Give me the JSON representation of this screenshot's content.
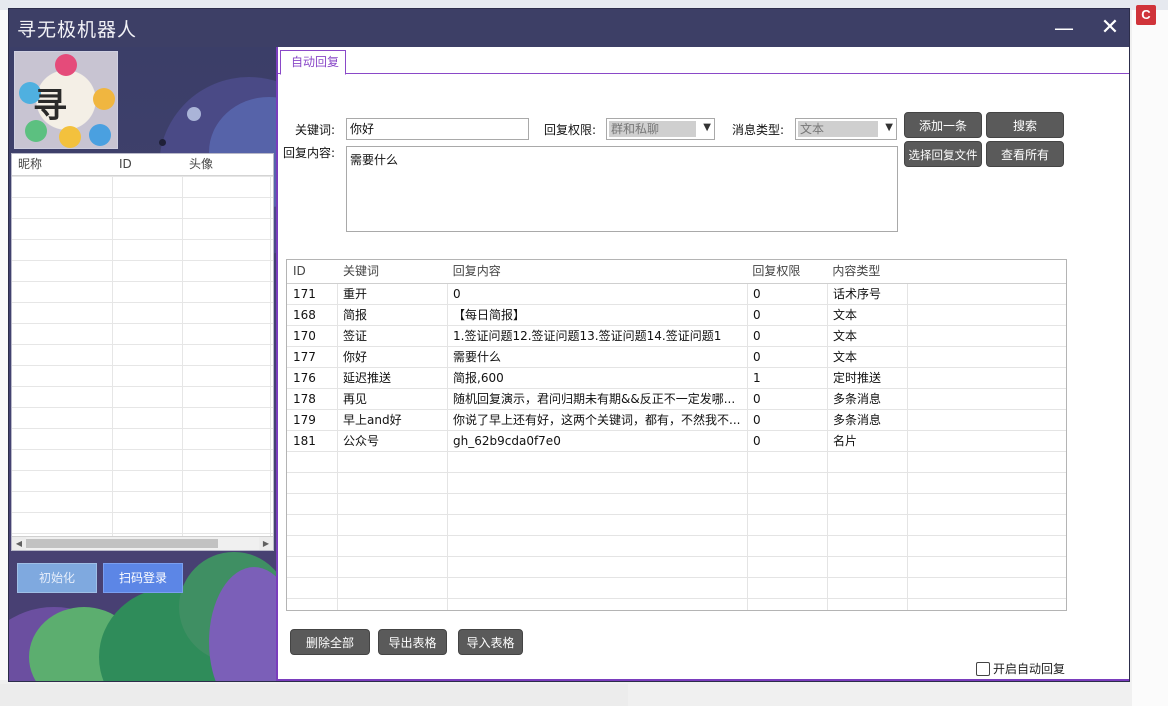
{
  "window": {
    "title": "寻无极机器人",
    "minimize_glyph": "—",
    "close_glyph": "✕"
  },
  "left": {
    "avatar_text": "寻",
    "contacts": {
      "columns": [
        "昵称",
        "ID",
        "头像"
      ],
      "rows": []
    },
    "buttons": {
      "init": "初始化",
      "scan_login": "扫码登录"
    }
  },
  "tab": {
    "label": "自动回复"
  },
  "form": {
    "keyword_label": "关键词:",
    "keyword_value": "你好",
    "permission_label": "回复权限:",
    "permission_value": "群和私聊",
    "msg_type_label": "消息类型:",
    "msg_type_value": "文本",
    "content_label": "回复内容:",
    "content_value": "需要什么"
  },
  "actions": {
    "add_one": "添加一条",
    "search": "搜索",
    "choose_file": "选择回复文件",
    "view_all": "查看所有",
    "delete_all": "删除全部",
    "export_table": "导出表格",
    "import_table": "导入表格",
    "auto_reply_toggle": "开启自动回复"
  },
  "table": {
    "columns": [
      "ID",
      "关键词",
      "回复内容",
      "回复权限",
      "内容类型"
    ],
    "rows": [
      [
        "171",
        "重开",
        "0",
        "0",
        "话术序号"
      ],
      [
        "168",
        "简报",
        "【每日简报】",
        "0",
        "文本"
      ],
      [
        "170",
        "签证",
        "1.签证问题12.签证问题13.签证问题14.签证问题1",
        "0",
        "文本"
      ],
      [
        "177",
        "你好",
        "需要什么",
        "0",
        "文本"
      ],
      [
        "176",
        "延迟推送",
        "简报,600",
        "1",
        "定时推送"
      ],
      [
        "178",
        "再见",
        "随机回复演示，君问归期未有期&&反正不一定发哪...",
        "0",
        "多条消息"
      ],
      [
        "179",
        "早上and好",
        "你说了早上还有好，这两个关键词，都有，不然我不...",
        "0",
        "多条消息"
      ],
      [
        "181",
        "公众号",
        "gh_62b9cda0f7e0",
        "0",
        "名片"
      ]
    ]
  },
  "colors": {
    "accent_purple": "#7a3dbd",
    "titlebar": "#3d3f66",
    "dark_button": "#5a5a5a",
    "init_button": "#7fa9df",
    "scan_button": "#5c86e6"
  }
}
